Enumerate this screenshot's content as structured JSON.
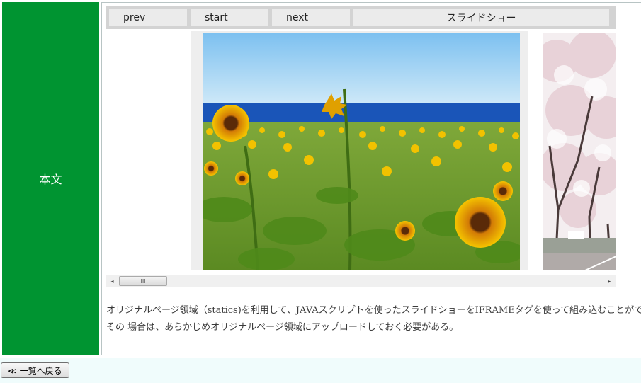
{
  "sidebar": {
    "label": "本文",
    "color": "#009431"
  },
  "slideshow": {
    "buttons": {
      "prev": "prev",
      "start": "start",
      "next": "next"
    },
    "title": "スライドショー"
  },
  "images": [
    {
      "name": "sunflower-field-photo"
    },
    {
      "name": "cherry-blossom-photo"
    }
  ],
  "scrollbar": {
    "thumb_grip": "III",
    "left_arrow": "◂",
    "right_arrow": "▸"
  },
  "description": {
    "line1": "オリジナルページ領域（statics)を利用して、JAVAスクリプトを使ったスライドショーをIFRAMEタグを使って組み込むことができる。",
    "line2": "その 場合は、あらかじめオリジナルページ領域にアップロードしておく必要がある。"
  },
  "footer": {
    "back_label": "≪ 一覧へ戻る"
  }
}
